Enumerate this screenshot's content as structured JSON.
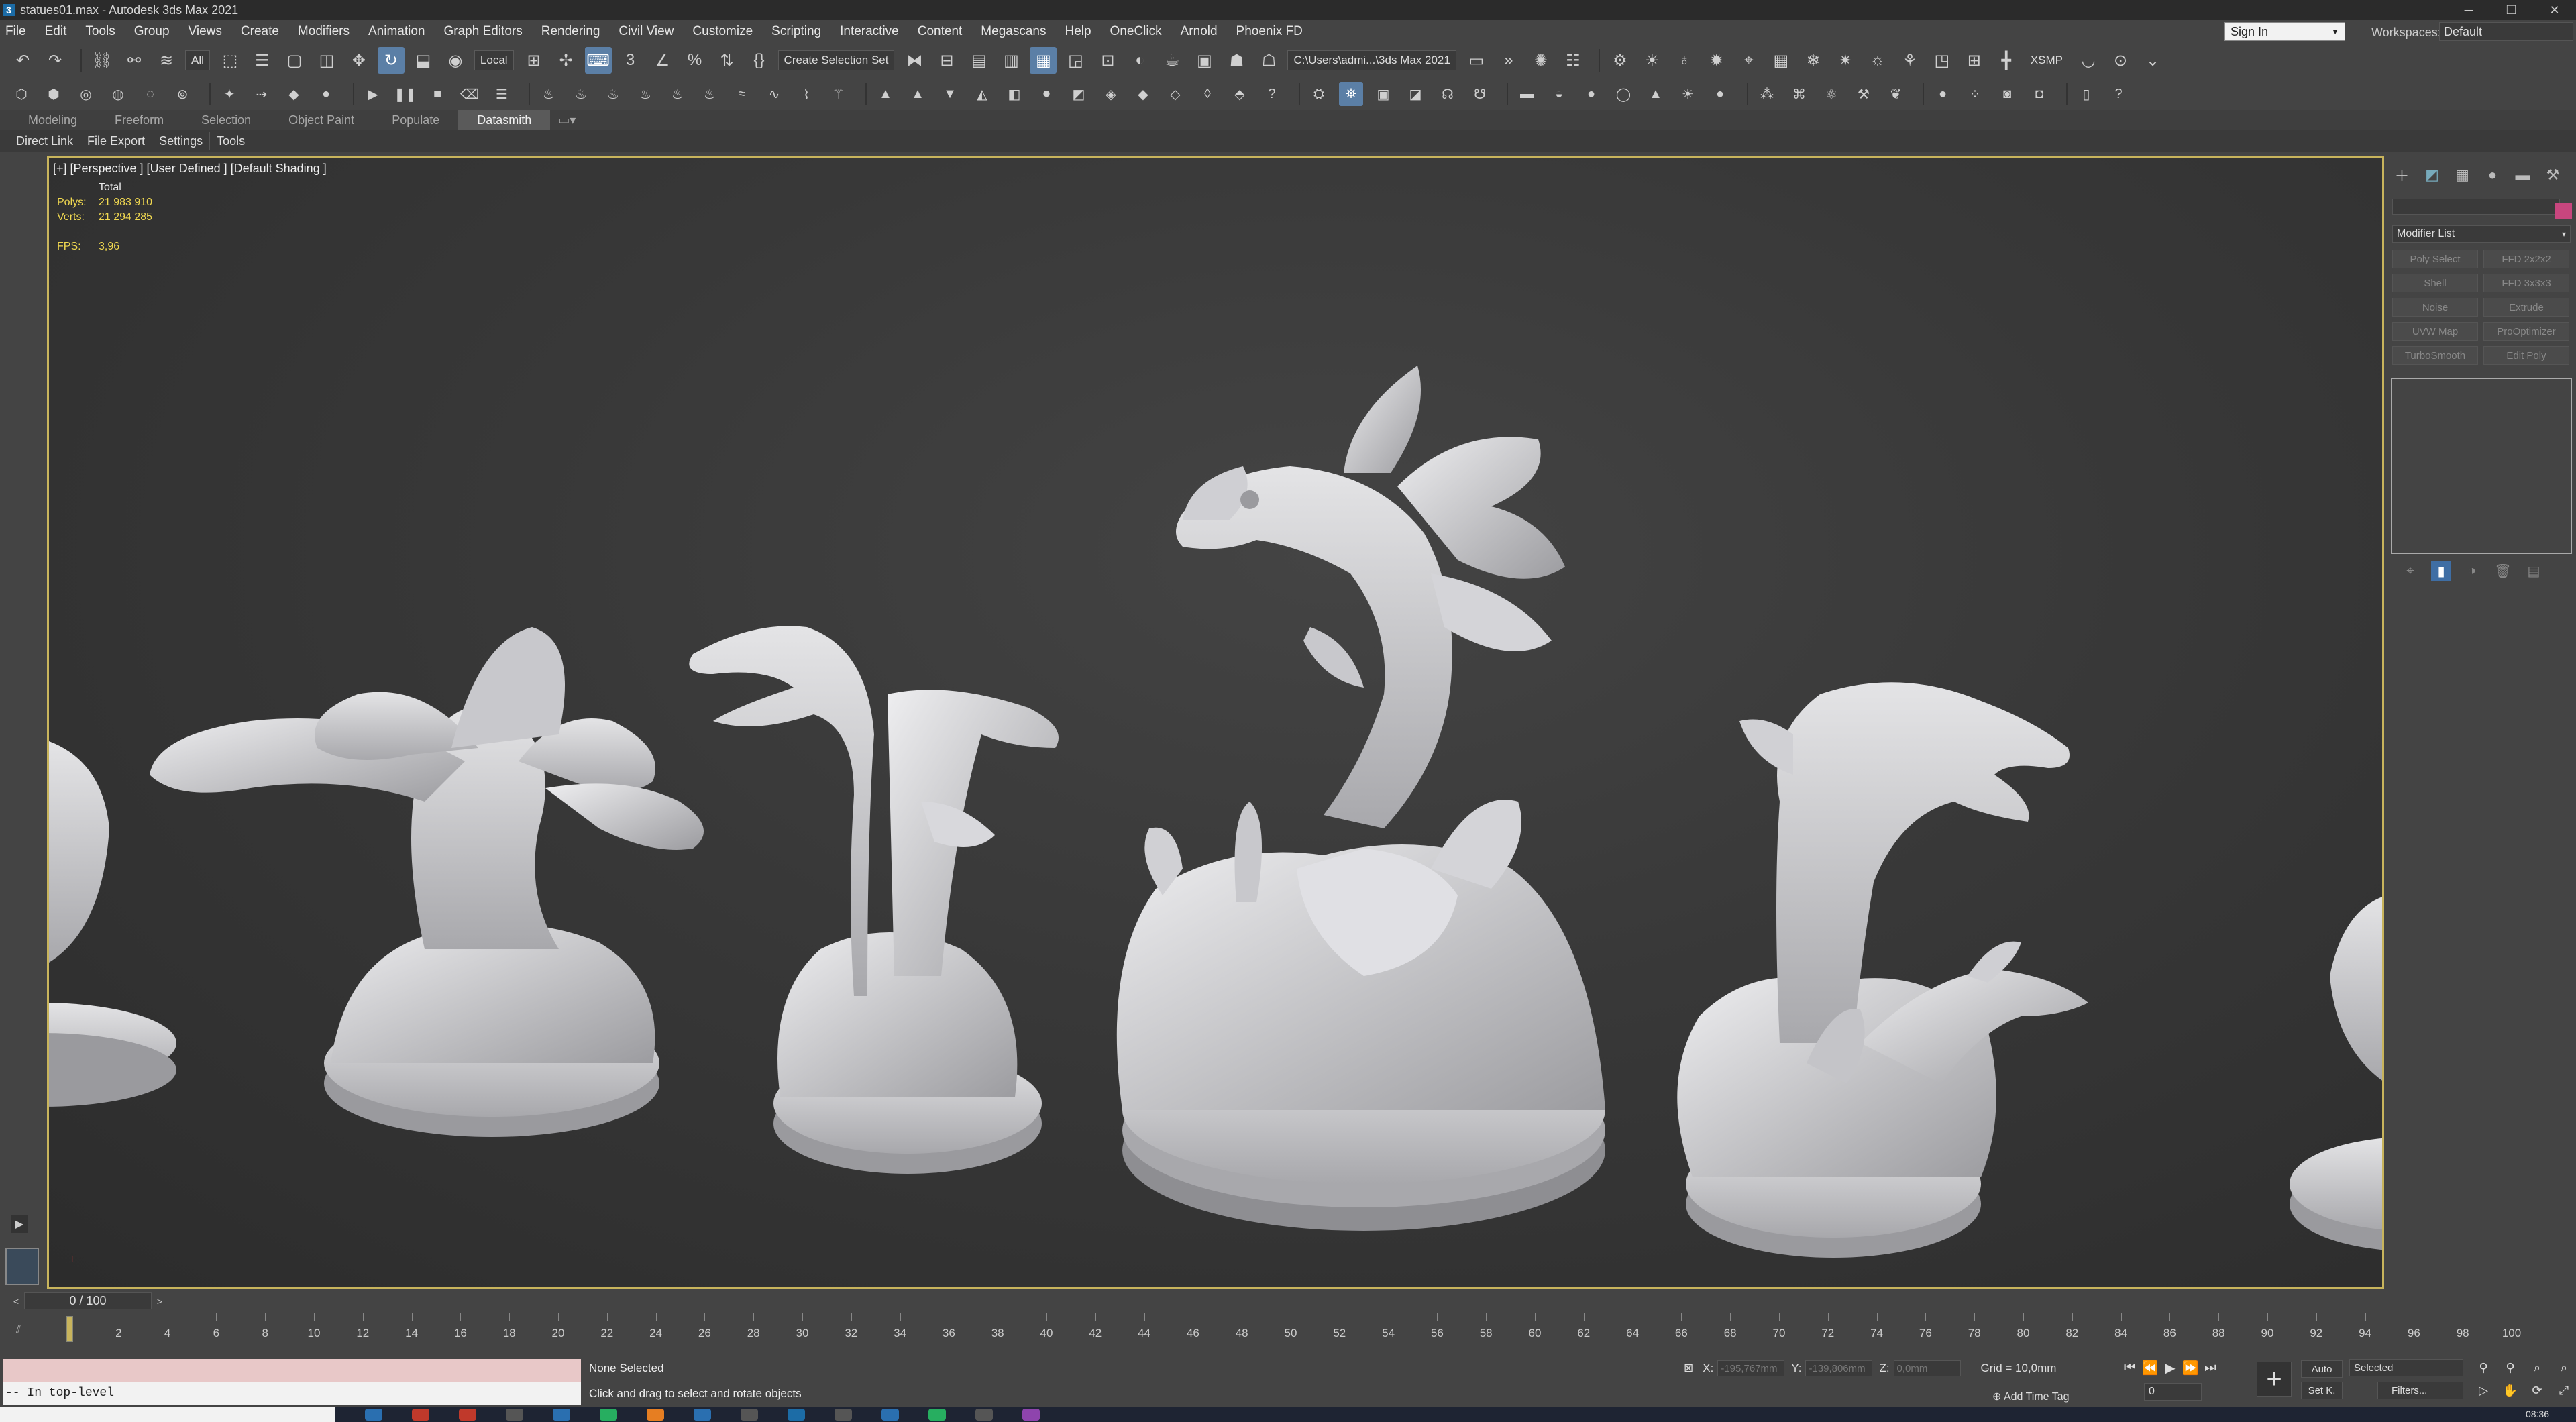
{
  "window": {
    "title": "statues01.max - Autodesk 3ds Max 2021",
    "logo_letter": "3",
    "controls": [
      "─",
      "❐",
      "✕"
    ]
  },
  "menubar": {
    "items": [
      "File",
      "Edit",
      "Tools",
      "Group",
      "Views",
      "Create",
      "Modifiers",
      "Animation",
      "Graph Editors",
      "Rendering",
      "Civil View",
      "Customize",
      "Scripting",
      "Interactive",
      "Content",
      "Megascans",
      "Help",
      "OneClick",
      "Arnold",
      "Phoenix FD"
    ],
    "sign_in": "Sign In",
    "workspaces_label": "Workspaces:",
    "workspace_value": "Default"
  },
  "toolbar": {
    "selection_filter": "All",
    "ref_coord": "Local",
    "named_selection": "Create Selection Set",
    "project_path": "C:\\Users\\admi...\\3ds Max 2021",
    "xsmp_label": "XSMP"
  },
  "ribbon": {
    "tabs": [
      "Modeling",
      "Freeform",
      "Selection",
      "Object Paint",
      "Populate",
      "Datasmith"
    ],
    "active_tab": "Datasmith"
  },
  "subtabs": [
    "Direct Link",
    "File Export",
    "Settings",
    "Tools"
  ],
  "viewport": {
    "label": "[+] [Perspective ] [User Defined ] [Default Shading ]",
    "stats_header": "Total",
    "polys_label": "Polys:",
    "polys_value": "21 983 910",
    "verts_label": "Verts:",
    "verts_value": "21 294 285",
    "fps_label": "FPS:",
    "fps_value": "3,96"
  },
  "command_panel": {
    "modifier_list": "Modifier List",
    "modifier_buttons": [
      "Poly Select",
      "FFD 2x2x2",
      "Shell",
      "FFD 3x3x3",
      "Noise",
      "Extrude",
      "UVW Map",
      "ProOptimizer",
      "TurboSmooth",
      "Edit Poly"
    ],
    "accent_color": "#c8467e"
  },
  "timeline": {
    "slider_text": "0 / 100",
    "current_frame": 0,
    "ticks": [
      "0",
      "2",
      "4",
      "6",
      "8",
      "10",
      "12",
      "14",
      "16",
      "18",
      "20",
      "22",
      "24",
      "26",
      "28",
      "30",
      "32",
      "34",
      "36",
      "38",
      "40",
      "42",
      "44",
      "46",
      "48",
      "50",
      "52",
      "54",
      "56",
      "58",
      "60",
      "62",
      "64",
      "66",
      "68",
      "70",
      "72",
      "74",
      "76",
      "78",
      "80",
      "82",
      "84",
      "86",
      "88",
      "90",
      "92",
      "94",
      "96",
      "98",
      "100"
    ]
  },
  "status": {
    "script_output": "-- In top-level",
    "selection": "None Selected",
    "prompt": "Click and drag to select and rotate objects",
    "x_label": "X:",
    "x_value": "-195,767mm",
    "y_label": "Y:",
    "y_value": "-139,806mm",
    "z_label": "Z:",
    "z_value": "0,0mm",
    "grid": "Grid = 10,0mm",
    "add_time_tag": "Add Time Tag",
    "frame_value": "0",
    "auto_key": "Auto",
    "set_key": "Set K.",
    "key_filter": "Selected",
    "filters": "Filters..."
  },
  "taskbar": {
    "clock": "08:36"
  }
}
